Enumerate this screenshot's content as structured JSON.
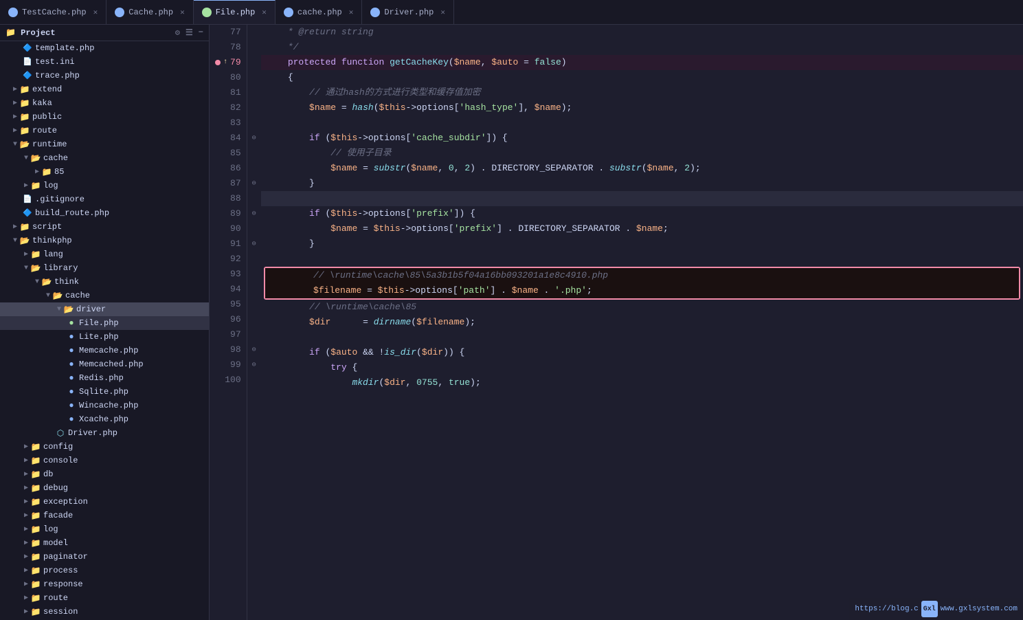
{
  "tabs": [
    {
      "id": "test-cache",
      "label": "TestCache.php",
      "icon": "php-blue",
      "active": false
    },
    {
      "id": "cache-php",
      "label": "Cache.php",
      "icon": "php-blue",
      "active": false
    },
    {
      "id": "file-php",
      "label": "File.php",
      "icon": "php-green",
      "active": true
    },
    {
      "id": "cache-php2",
      "label": "cache.php",
      "icon": "php-blue",
      "active": false
    },
    {
      "id": "driver-php",
      "label": "Driver.php",
      "icon": "php-blue",
      "active": false
    }
  ],
  "sidebar": {
    "header": "Project",
    "items": [
      {
        "label": "template.php",
        "indent": 2,
        "type": "file-blue",
        "arrow": false
      },
      {
        "label": "test.ini",
        "indent": 2,
        "type": "file-gray",
        "arrow": false
      },
      {
        "label": "trace.php",
        "indent": 2,
        "type": "file-blue",
        "arrow": false
      },
      {
        "label": "extend",
        "indent": 1,
        "type": "folder",
        "arrow": "▶"
      },
      {
        "label": "kaka",
        "indent": 1,
        "type": "folder",
        "arrow": "▶"
      },
      {
        "label": "public",
        "indent": 1,
        "type": "folder",
        "arrow": "▶"
      },
      {
        "label": "route",
        "indent": 1,
        "type": "folder",
        "arrow": "▶"
      },
      {
        "label": "runtime",
        "indent": 1,
        "type": "folder",
        "arrow": "▼"
      },
      {
        "label": "cache",
        "indent": 2,
        "type": "folder",
        "arrow": "▼"
      },
      {
        "label": "85",
        "indent": 3,
        "type": "folder",
        "arrow": "▶"
      },
      {
        "label": "log",
        "indent": 2,
        "type": "folder",
        "arrow": "▶"
      },
      {
        "label": ".gitignore",
        "indent": 2,
        "type": "file-gray",
        "arrow": false
      },
      {
        "label": "build_route.php",
        "indent": 2,
        "type": "file-blue",
        "arrow": false
      },
      {
        "label": "script",
        "indent": 1,
        "type": "folder",
        "arrow": "▶"
      },
      {
        "label": "thinkphp",
        "indent": 1,
        "type": "folder",
        "arrow": "▼"
      },
      {
        "label": "lang",
        "indent": 2,
        "type": "folder",
        "arrow": "▶"
      },
      {
        "label": "library",
        "indent": 2,
        "type": "folder",
        "arrow": "▼"
      },
      {
        "label": "think",
        "indent": 3,
        "type": "folder",
        "arrow": "▼"
      },
      {
        "label": "cache",
        "indent": 4,
        "type": "folder",
        "arrow": "▼"
      },
      {
        "label": "driver",
        "indent": 5,
        "type": "folder",
        "arrow": "▼",
        "active": true
      },
      {
        "label": "File.php",
        "indent": 6,
        "type": "file-blue-active",
        "arrow": false,
        "selected": true
      },
      {
        "label": "Lite.php",
        "indent": 6,
        "type": "file-blue",
        "arrow": false
      },
      {
        "label": "Memcache.php",
        "indent": 6,
        "type": "file-blue",
        "arrow": false
      },
      {
        "label": "Memcached.php",
        "indent": 6,
        "type": "file-blue",
        "arrow": false
      },
      {
        "label": "Redis.php",
        "indent": 6,
        "type": "file-blue",
        "arrow": false
      },
      {
        "label": "Sqlite.php",
        "indent": 6,
        "type": "file-blue",
        "arrow": false
      },
      {
        "label": "Wincache.php",
        "indent": 6,
        "type": "file-blue",
        "arrow": false
      },
      {
        "label": "Xcache.php",
        "indent": 6,
        "type": "file-blue",
        "arrow": false
      },
      {
        "label": "Driver.php",
        "indent": 5,
        "type": "file-icon",
        "arrow": false
      },
      {
        "label": "config",
        "indent": 2,
        "type": "folder",
        "arrow": "▶"
      },
      {
        "label": "console",
        "indent": 2,
        "type": "folder",
        "arrow": "▶"
      },
      {
        "label": "db",
        "indent": 2,
        "type": "folder",
        "arrow": "▶"
      },
      {
        "label": "debug",
        "indent": 2,
        "type": "folder",
        "arrow": "▶"
      },
      {
        "label": "exception",
        "indent": 2,
        "type": "folder",
        "arrow": "▶"
      },
      {
        "label": "facade",
        "indent": 2,
        "type": "folder",
        "arrow": "▶"
      },
      {
        "label": "log",
        "indent": 2,
        "type": "folder",
        "arrow": "▶"
      },
      {
        "label": "model",
        "indent": 2,
        "type": "folder",
        "arrow": "▶"
      },
      {
        "label": "paginator",
        "indent": 2,
        "type": "folder",
        "arrow": "▶"
      },
      {
        "label": "process",
        "indent": 2,
        "type": "folder",
        "arrow": "▶"
      },
      {
        "label": "response",
        "indent": 2,
        "type": "folder",
        "arrow": "▶"
      },
      {
        "label": "route",
        "indent": 2,
        "type": "folder",
        "arrow": "▶"
      },
      {
        "label": "session",
        "indent": 2,
        "type": "folder",
        "arrow": "▶"
      }
    ]
  },
  "code_lines": [
    {
      "num": 77,
      "gutter": "",
      "content": "    * @return string",
      "type": "comment"
    },
    {
      "num": 78,
      "gutter": "",
      "content": "    */",
      "type": "comment"
    },
    {
      "num": 79,
      "gutter": "bp",
      "content": "    protected function getCacheKey($name, $auto = false)",
      "type": "code",
      "breakpoint": true
    },
    {
      "num": 80,
      "gutter": "",
      "content": "    {",
      "type": "code"
    },
    {
      "num": 81,
      "gutter": "",
      "content": "        // 通过hash的方式进行类型和缓存值加密",
      "type": "comment"
    },
    {
      "num": 82,
      "gutter": "",
      "content": "        $name = hash($this->options['hash_type'], $name);",
      "type": "code"
    },
    {
      "num": 83,
      "gutter": "",
      "content": "",
      "type": "code"
    },
    {
      "num": 84,
      "gutter": "fold",
      "content": "        if ($this->options['cache_subdir']) {",
      "type": "code"
    },
    {
      "num": 85,
      "gutter": "",
      "content": "            // 使用子目录",
      "type": "comment"
    },
    {
      "num": 86,
      "gutter": "",
      "content": "            $name = substr($name, 0, 2) . DIRECTORY_SEPARATOR . substr($name, 2);",
      "type": "code"
    },
    {
      "num": 87,
      "gutter": "fold",
      "content": "        }",
      "type": "code"
    },
    {
      "num": 88,
      "gutter": "",
      "content": "",
      "type": "current"
    },
    {
      "num": 89,
      "gutter": "fold",
      "content": "        if ($this->options['prefix']) {",
      "type": "code"
    },
    {
      "num": 90,
      "gutter": "",
      "content": "            $name = $this->options['prefix'] . DIRECTORY_SEPARATOR . $name;",
      "type": "code"
    },
    {
      "num": 91,
      "gutter": "fold",
      "content": "        }",
      "type": "code"
    },
    {
      "num": 92,
      "gutter": "",
      "content": "",
      "type": "code"
    },
    {
      "num": 93,
      "gutter": "",
      "content": "        // \\runtime\\cache\\85\\5a3b1b5f04a16bb093201a1e8c4910.php",
      "type": "highlight-comment"
    },
    {
      "num": 94,
      "gutter": "",
      "content": "        $filename = $this->options['path'] . $name . '.php';",
      "type": "highlight-code"
    },
    {
      "num": 95,
      "gutter": "",
      "content": "        // \\runtime\\cache\\85",
      "type": "comment"
    },
    {
      "num": 96,
      "gutter": "",
      "content": "        $dir      = dirname($filename);",
      "type": "code"
    },
    {
      "num": 97,
      "gutter": "",
      "content": "",
      "type": "code"
    },
    {
      "num": 98,
      "gutter": "fold",
      "content": "        if ($auto && !is_dir($dir)) {",
      "type": "code"
    },
    {
      "num": 99,
      "gutter": "fold",
      "content": "            try {",
      "type": "code"
    },
    {
      "num": 100,
      "gutter": "",
      "content": "                mkdir($dir, 0755, true);",
      "type": "code"
    }
  ],
  "watermark": {
    "url": "https://blog.c",
    "logo_text": "Gxl",
    "site": "www.gxlsystem.com"
  }
}
